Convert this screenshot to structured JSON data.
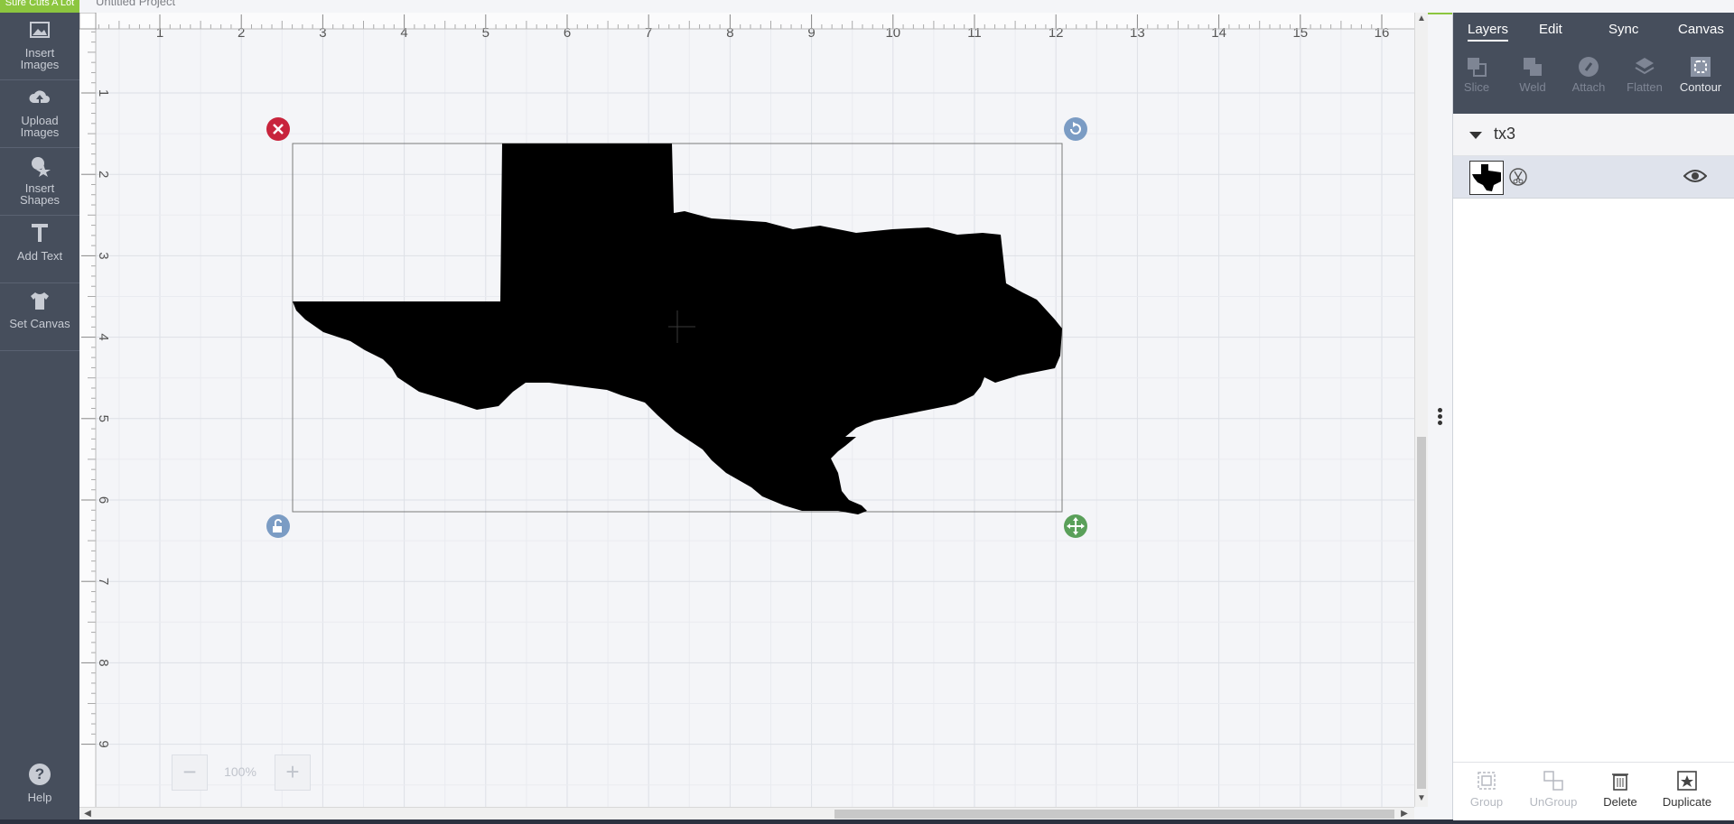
{
  "app": {
    "brand": "Sure Cuts A Lot",
    "project_title": "Untitled Project"
  },
  "sidebar": {
    "items": [
      {
        "label": "Insert\nImages",
        "icon": "image-icon"
      },
      {
        "label": "Upload\nImages",
        "icon": "cloud-upload-icon"
      },
      {
        "label": "Insert\nShapes",
        "icon": "shapes-icon"
      },
      {
        "label": "Add Text",
        "icon": "text-icon"
      },
      {
        "label": "Set Canvas",
        "icon": "tshirt-icon"
      }
    ],
    "help_label": "Help"
  },
  "rulers": {
    "horizontal": [
      "1",
      "2",
      "3",
      "4",
      "5",
      "6",
      "7",
      "8",
      "9",
      "10",
      "11",
      "12",
      "13",
      "14",
      "15",
      "16"
    ],
    "vertical": [
      "1",
      "2",
      "3",
      "4",
      "5",
      "6",
      "7",
      "8",
      "9"
    ]
  },
  "zoom": {
    "minus": "−",
    "value": "100%",
    "plus": "+"
  },
  "panel": {
    "tabs": [
      "Layers",
      "Edit",
      "Sync",
      "Canvas"
    ],
    "active_tab": "Layers",
    "tools": [
      "Slice",
      "Weld",
      "Attach",
      "Flatten",
      "Contour"
    ],
    "group_name": "tx3",
    "bottom_actions": [
      "Group",
      "UnGroup",
      "Delete",
      "Duplicate"
    ]
  },
  "colors": {
    "sidebar": "#464e5c",
    "accent": "#8cc63f",
    "delete_handle": "#c8243c",
    "rotate_handle": "#7b9cc4",
    "move_handle": "#5aa05a"
  }
}
